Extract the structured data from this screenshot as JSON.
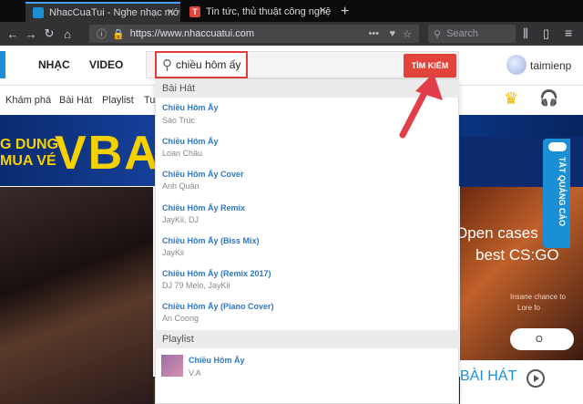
{
  "browser": {
    "tabs": [
      {
        "title": "NhacCuaTui - Nghe nhạc mới ..."
      },
      {
        "title": "Tin tức, thủ thuật công nghệ m..."
      }
    ],
    "new_tab": "+",
    "url": "https://www.nhaccuatui.com",
    "search_placeholder": "Search"
  },
  "site": {
    "nav_tabs": [
      "NHẠC",
      "VIDEO"
    ],
    "search_value": "chiều hôm ấy",
    "search_button": "TÌM KIẾM",
    "username": "taimienp",
    "subnav": [
      "Khám phá",
      "Bài Hát",
      "Playlist",
      "Tu"
    ],
    "banner_left": "G DUNG\nMUA VÉ",
    "banner_big": "VBA",
    "side_tab": "TẮT QUẢNG CÁO",
    "ad_line1": "Open cases",
    "ad_line2": "best CS:GO",
    "ad_small1": "Insane chance to",
    "ad_small2": "Lore fo",
    "ad_oval": "O",
    "bai_hat": "BÀI HÁT"
  },
  "dropdown": {
    "section_songs": "Bài Hát",
    "songs": [
      {
        "title": "Chiều Hôm Ấy",
        "artist": "Sáo Trúc"
      },
      {
        "title": "Chiều Hôm Ấy",
        "artist": "Loan Châu"
      },
      {
        "title": "Chiều Hôm Ấy Cover",
        "artist": "Anh Quân"
      },
      {
        "title": "Chiều Hôm Ấy Remix",
        "artist": "JayKii, DJ"
      },
      {
        "title": "Chiều Hôm Ấy (Biss Mix)",
        "artist": "JayKii"
      },
      {
        "title": "Chiều Hôm Ấy (Remix 2017)",
        "artist": "DJ 79 Melo, JayKii"
      },
      {
        "title": "Chiều Hôm Ấy (Piano Cover)",
        "artist": "An Coong"
      }
    ],
    "section_playlist": "Playlist",
    "playlists": [
      {
        "title": "Chiều Hôm Ấy",
        "artist": "V.A"
      }
    ]
  },
  "colors": {
    "accent": "#e2433a",
    "link": "#2e78c8",
    "arrow": "#e23d4a"
  }
}
